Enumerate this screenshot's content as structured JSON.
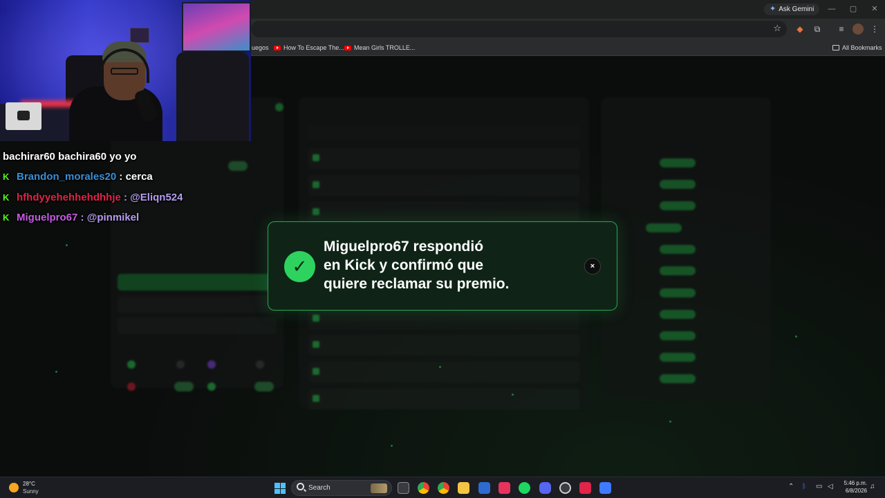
{
  "browser": {
    "ask_gemini_label": "Ask Gemini",
    "bookmarks": [
      {
        "label": "uegos"
      },
      {
        "label": "How To Escape The..."
      },
      {
        "label": "Mean Girls TROLLE..."
      }
    ],
    "all_bookmarks_label": "All Bookmarks"
  },
  "chat": {
    "messages": [
      {
        "user": "bachirar60",
        "text": "bachira60 yo yo",
        "user_color": "#ffffff",
        "kick_badge": false
      },
      {
        "user": "Brandon_morales20",
        "text": ": cerca",
        "user_color": "#3a8fd6",
        "kick_badge": true
      },
      {
        "user": "hfhdyyehehhehdhhje",
        "text": ": @Eliqn524",
        "user_color": "#e0244a",
        "kick_badge": true
      },
      {
        "user": "Miguelpro67",
        "text": ": @pinmikel",
        "user_color": "#c65be3",
        "kick_badge": true
      }
    ]
  },
  "toast": {
    "message_line1": "Miguelpro67 respondió",
    "message_line2": "en Kick y confirmó que",
    "message_line3": "quiere reclamar su premio.",
    "icon": "check-icon",
    "close_label": "×",
    "accent_color": "#2ed25e"
  },
  "taskbar": {
    "weather_temp": "28°C",
    "weather_condition": "Sunny",
    "search_label": "Search",
    "clock_time": "5:46 p.m.",
    "clock_date": "6/8/2026"
  },
  "colors": {
    "kick_green": "#53fc18",
    "toast_bg": "#0f2417",
    "toast_border": "#2aa752"
  }
}
